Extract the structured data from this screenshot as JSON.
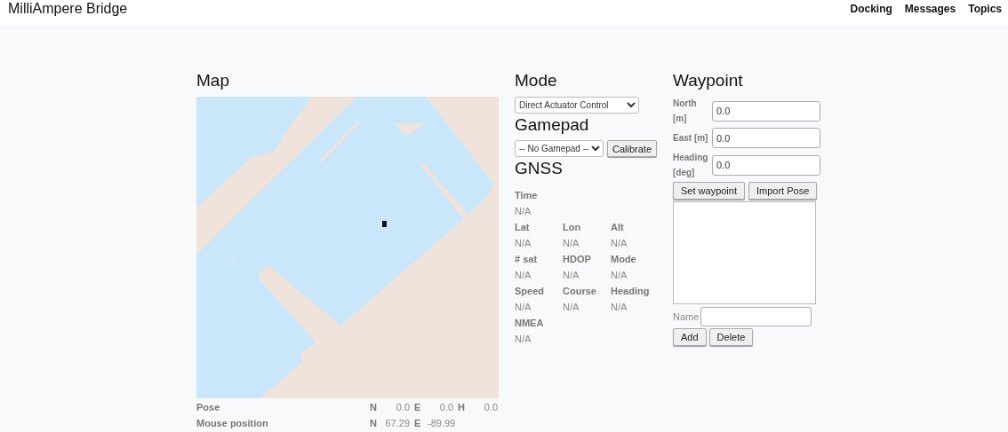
{
  "header": {
    "title": "MilliAmpere Bridge",
    "nav": [
      "Docking",
      "Messages",
      "Topics"
    ]
  },
  "map": {
    "title": "Map",
    "rows": [
      {
        "label": "Pose",
        "cells": [
          {
            "axis": "N",
            "value": "0.0"
          },
          {
            "axis": "E",
            "value": "0.0"
          },
          {
            "axis": "H",
            "value": "0.0"
          }
        ]
      },
      {
        "label": "Mouse position",
        "cells": [
          {
            "axis": "N",
            "value": "67.29"
          },
          {
            "axis": "E",
            "value": "-89.99"
          }
        ]
      }
    ]
  },
  "mode": {
    "title": "Mode",
    "selected_option": "Direct Actuator Control"
  },
  "gamepad": {
    "title": "Gamepad",
    "selected_option": "-- No Gamepad --",
    "button": "Calibrate"
  },
  "gnss": {
    "title": "GNSS",
    "rows": [
      [
        {
          "label": "Time",
          "value": "N/A"
        }
      ],
      [
        {
          "label": "Lat",
          "value": "N/A"
        },
        {
          "label": "Lon",
          "value": "N/A"
        },
        {
          "label": "Alt",
          "value": "N/A"
        }
      ],
      [
        {
          "label": "# sat",
          "value": "N/A"
        },
        {
          "label": "HDOP",
          "value": "N/A"
        },
        {
          "label": "Mode",
          "value": "N/A"
        }
      ],
      [
        {
          "label": "Speed",
          "value": "N/A"
        },
        {
          "label": "Course",
          "value": "N/A"
        },
        {
          "label": "Heading",
          "value": "N/A"
        }
      ],
      [
        {
          "label": "NMEA",
          "value": "N/A"
        }
      ]
    ]
  },
  "waypoint": {
    "title": "Waypoint",
    "fields": [
      {
        "label": "North [m]",
        "value": "0.0"
      },
      {
        "label": "East [m]",
        "value": "0.0"
      },
      {
        "label": "Heading [deg]",
        "value": "0.0"
      }
    ],
    "buttons": [
      "Set waypoint",
      "Import Pose"
    ],
    "name_label": "Name",
    "list_buttons": [
      "Add",
      "Delete"
    ]
  }
}
